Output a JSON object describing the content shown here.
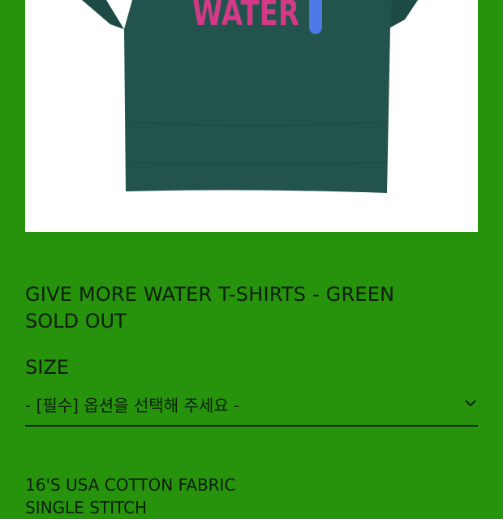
{
  "product": {
    "image_print": "WATER",
    "title": "GIVE MORE WATER T-SHIRTS - GREEN",
    "status": "SOLD OUT"
  },
  "options": {
    "size_label": "SIZE",
    "select_value": "- [필수] 옵션을 선택해 주세요 -",
    "icon": "chevron-down-icon"
  },
  "description": {
    "lines": [
      "16'S USA COTTON FABRIC",
      "SINGLE STITCH"
    ]
  },
  "colors": {
    "background": "#27920b",
    "text": "#0c1f0c",
    "shirt": "#22534d",
    "print_pink": "#d23a87",
    "print_blue": "#4c78e6"
  }
}
